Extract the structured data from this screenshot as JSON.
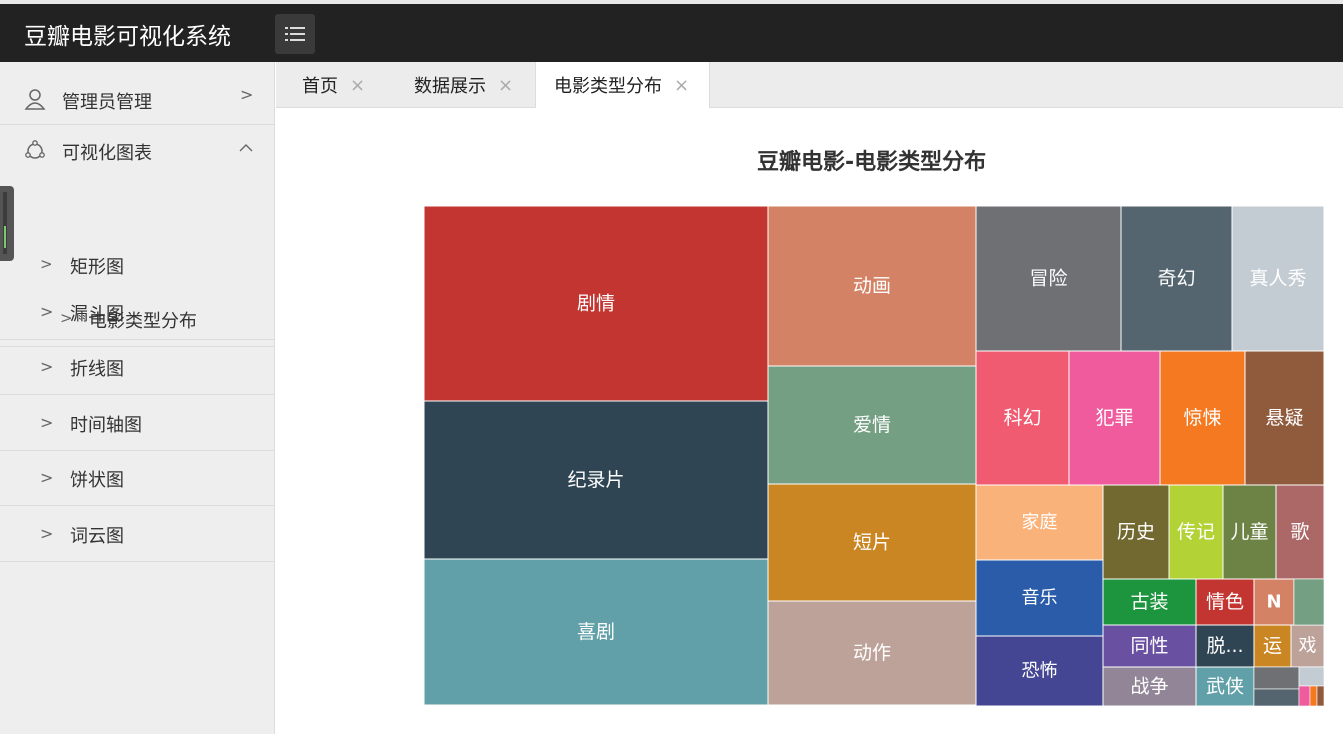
{
  "app": {
    "title": "豆瓣电影可视化系统"
  },
  "header": {
    "menu_icon": "hamburger-icon"
  },
  "sidebar": {
    "groups": [
      {
        "label": "管理员管理",
        "icon": "user-icon",
        "expanded": false
      },
      {
        "label": "可视化图表",
        "icon": "chart-icon",
        "expanded": true
      }
    ],
    "items": [
      {
        "label": "矩形图"
      },
      {
        "label": "电影类型分布"
      },
      {
        "label": "漏斗图"
      },
      {
        "label": "折线图"
      },
      {
        "label": "时间轴图"
      },
      {
        "label": "饼状图"
      },
      {
        "label": "词云图"
      }
    ]
  },
  "tabs": [
    {
      "label": "首页",
      "close": "×"
    },
    {
      "label": "数据展示",
      "close": "×"
    },
    {
      "label": "电影类型分布",
      "close": "×",
      "active": true
    }
  ],
  "chart_data": {
    "type": "treemap",
    "title": "豆瓣电影-电影类型分布",
    "items": [
      {
        "name": "剧情",
        "value": 676,
        "color": "#c23531"
      },
      {
        "name": "纪录片",
        "value": 544,
        "color": "#2f4554"
      },
      {
        "name": "喜剧",
        "value": 505,
        "color": "#61a0a8"
      },
      {
        "name": "动画",
        "value": 332,
        "color": "#d48265"
      },
      {
        "name": "爱情",
        "value": 247,
        "color": "#749f83"
      },
      {
        "name": "短片",
        "value": 241,
        "color": "#ca8622"
      },
      {
        "name": "动作",
        "value": 216,
        "color": "#bda29a"
      },
      {
        "name": "冒险",
        "value": 166,
        "color": "#6e7074"
      },
      {
        "name": "奇幻",
        "value": 129,
        "color": "#546570"
      },
      {
        "name": "真人秀",
        "value": 105,
        "color": "#c4ccd3"
      },
      {
        "name": "科幻",
        "value": 96,
        "color": "#f05b72"
      },
      {
        "name": "犯罪",
        "value": 94,
        "color": "#ef5b9c"
      },
      {
        "name": "惊悚",
        "value": 87,
        "color": "#f47920"
      },
      {
        "name": "悬疑",
        "value": 81,
        "color": "#905a3d"
      },
      {
        "name": "家庭",
        "value": 80,
        "color": "#fab27b"
      },
      {
        "name": "音乐",
        "value": 78,
        "color": "#2a5caa"
      },
      {
        "name": "恐怖",
        "value": 70,
        "color": "#444693"
      },
      {
        "name": "历史",
        "value": 46,
        "color": "#726930"
      },
      {
        "name": "传记",
        "value": 35,
        "color": "#b2d235"
      },
      {
        "name": "儿童",
        "value": 35,
        "color": "#6d8346"
      },
      {
        "name": "歌",
        "value": 31,
        "color": "#ac6767"
      },
      {
        "name": "古装",
        "value": 25,
        "color": "#1d953f"
      },
      {
        "name": "情色",
        "value": 17,
        "color": "#c23531"
      },
      {
        "name": "N",
        "value": 11,
        "color": "#d48265"
      },
      {
        "name": "同性",
        "value": 18,
        "color": "#6950a1"
      },
      {
        "name": "脱...",
        "value": 11,
        "color": "#2f4554"
      },
      {
        "name": "运",
        "value": 5,
        "color": "#ca8622"
      },
      {
        "name": "戏",
        "value": 4,
        "color": "#bda29a"
      },
      {
        "name": "战争",
        "value": 16,
        "color": "#918597"
      },
      {
        "name": "武侠",
        "value": 9,
        "color": "#61a0a8"
      }
    ]
  }
}
